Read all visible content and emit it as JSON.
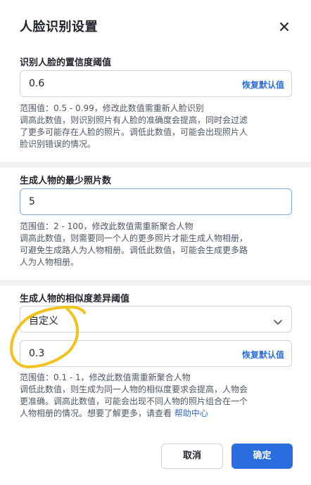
{
  "dialog": {
    "title": "人脸识别设置",
    "close_icon": "close-icon"
  },
  "face_threshold": {
    "label": "识别人脸的置信度阈值",
    "value": "0.6",
    "reset_label": "恢复默认值",
    "desc_lines": [
      "范围值：0.5 - 0.99，修改此数值需重新人脸识别",
      "调高此数值，则识别照片有人脸的准确度会提高，同时会过滤",
      "了更多可能存在人脸的照片。调低此数值，可能会出现照片人",
      "脸识别错误的情况。"
    ]
  },
  "min_photos": {
    "label": "生成人物的最少照片数",
    "value": "5",
    "desc_lines": [
      "范围值：2 - 100，修改此数值需重新聚合人物",
      "调高此数值，则需要同一个人的更多照片才能生成人物相册，",
      "可避免生成路人为人物相册。调低此数值，可能会生成更多路",
      "人为人物相册。"
    ]
  },
  "similarity": {
    "label": "生成人物的相似度差异阈值",
    "select_value": "自定义",
    "value": "0.3",
    "reset_label": "恢复默认值",
    "desc_lines": [
      "范围值：0.1 - 1，修改此数值需重新聚合人物",
      "调低此数值，则生成为同一人物的相似度要求会提高，人物会",
      "更准确。调高此数值，可能会出现不同人物的照片组合在一个"
    ],
    "desc_last_prefix": "人物相册的情况。想要了解更多，请查看 ",
    "help_link": "帮助中心"
  },
  "footer": {
    "cancel_label": "取消",
    "ok_label": "确定"
  },
  "colors": {
    "accent": "#2a6de0",
    "annotation_stroke": "#f2c21b"
  }
}
